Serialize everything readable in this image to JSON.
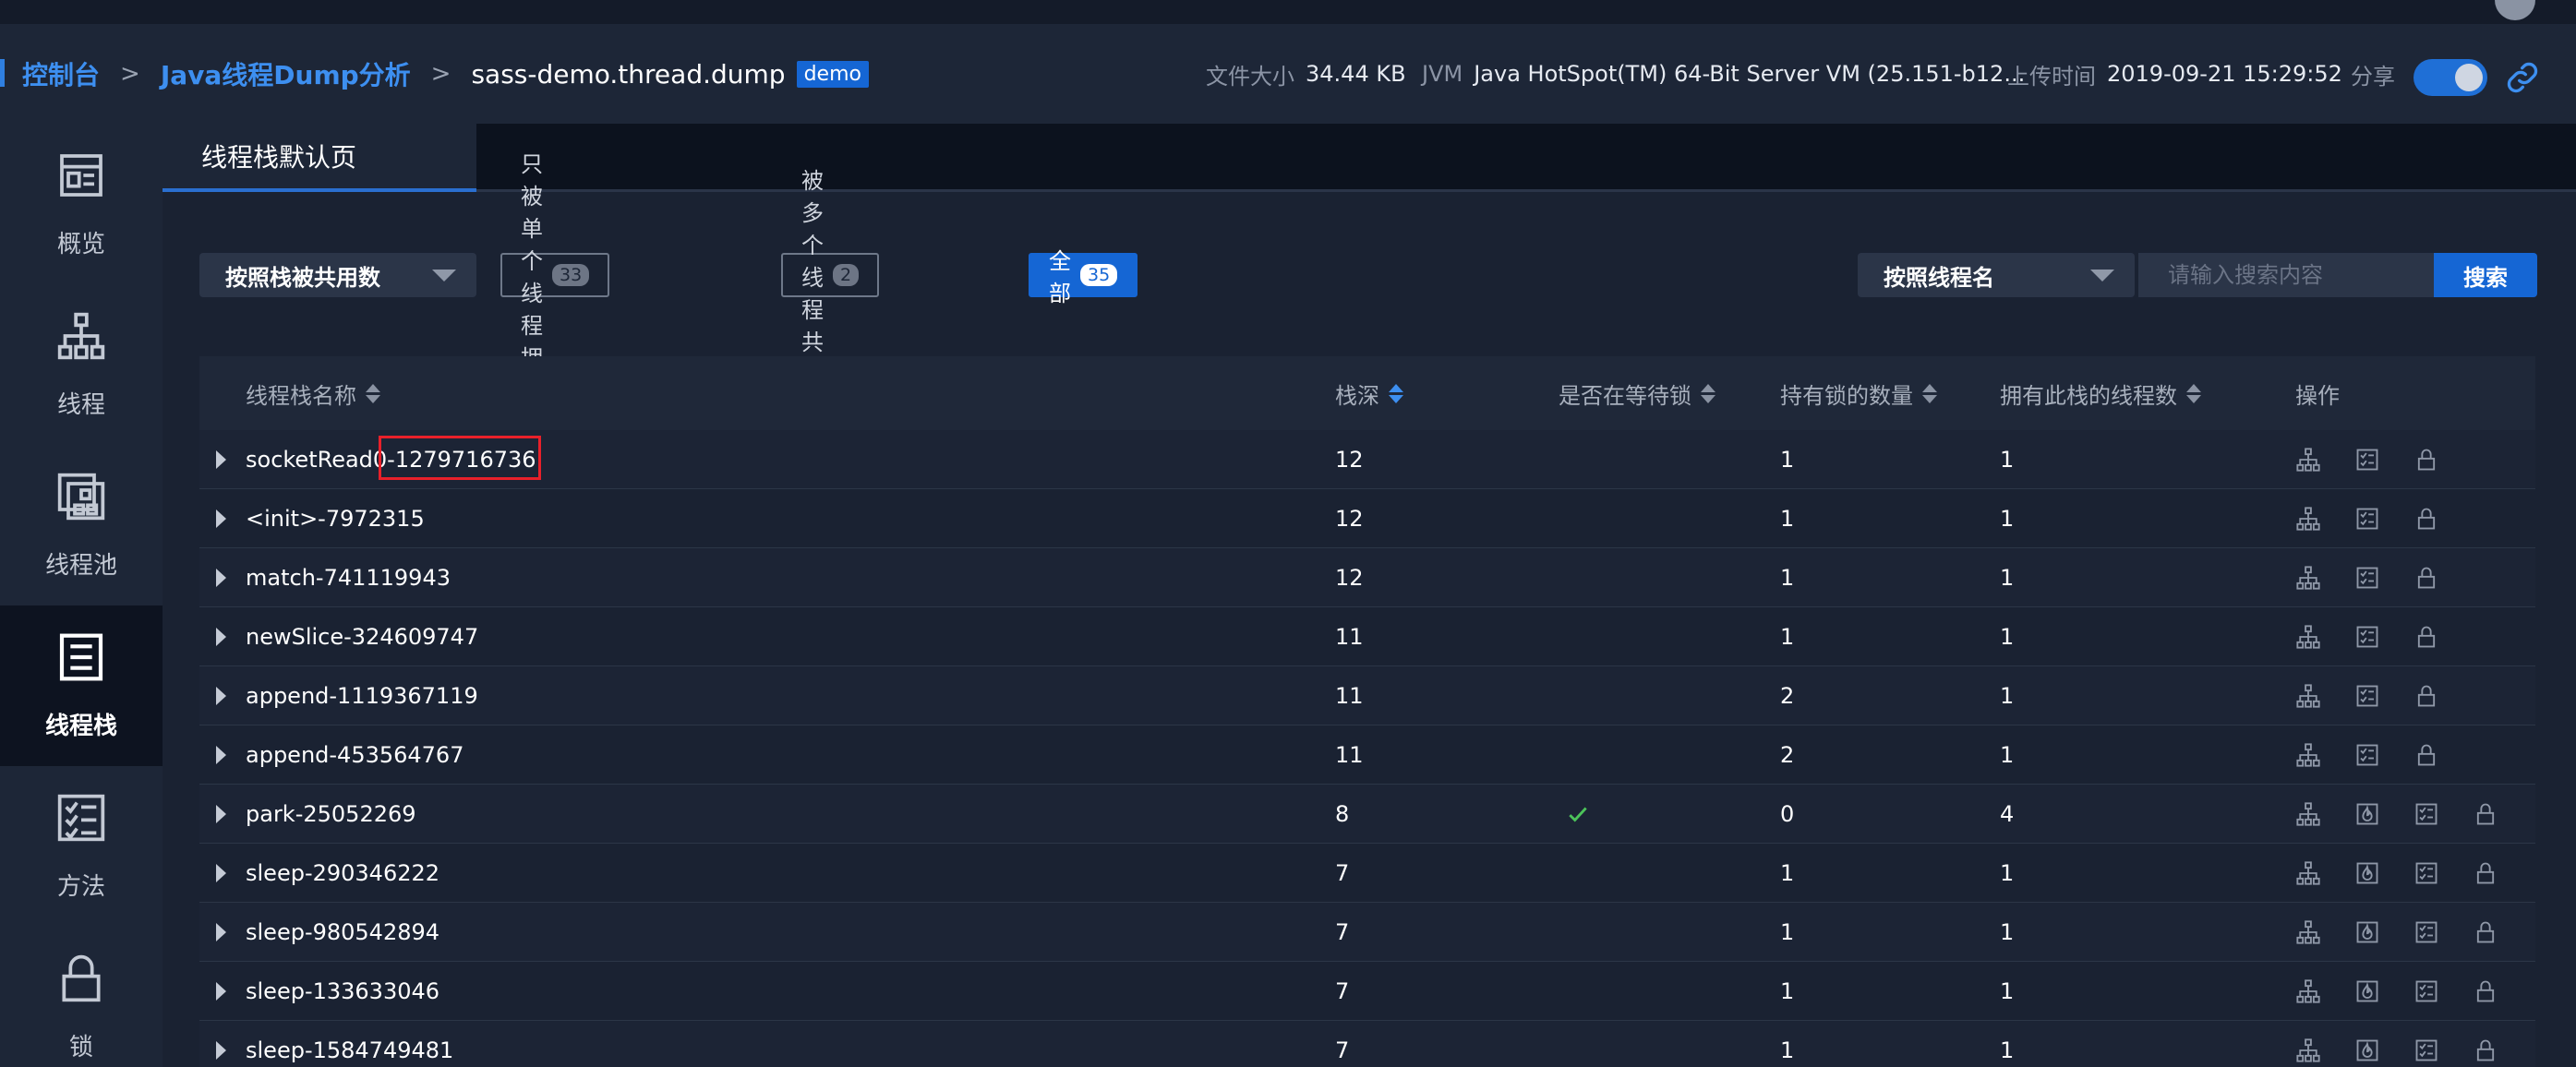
{
  "breadcrumb": {
    "console": "控制台",
    "sep1": ">",
    "analysis": "Java线程Dump分析",
    "sep2": ">",
    "file": "sass-demo.thread.dump",
    "tag": "demo"
  },
  "meta": {
    "size_label": "文件大小",
    "size_value": "34.44 KB",
    "jvm_label": "JVM",
    "jvm_value": "Java HotSpot(TM) 64-Bit Server VM (25.151-b12...",
    "upload_label": "上传时间",
    "upload_value": "2019-09-21 15:29:52",
    "share_label": "分享",
    "share_enabled": true
  },
  "sidebar": {
    "items": [
      {
        "label": "概览",
        "icon": "overview-icon",
        "active": false
      },
      {
        "label": "线程",
        "icon": "thread-tree-icon",
        "active": false
      },
      {
        "label": "线程池",
        "icon": "thread-pool-icon",
        "active": false
      },
      {
        "label": "线程栈",
        "icon": "thread-stack-icon",
        "active": true
      },
      {
        "label": "方法",
        "icon": "method-list-icon",
        "active": false
      },
      {
        "label": "锁",
        "icon": "lock-icon",
        "active": false
      }
    ]
  },
  "tabs": [
    {
      "label": "线程栈默认页",
      "active": true
    }
  ],
  "filters": {
    "sort_select": "按照栈被共用数",
    "single": {
      "label": "只被单个线程拥有",
      "count": "33"
    },
    "multi": {
      "label": "被多个线程共用",
      "count": "2"
    },
    "all": {
      "label": "全部",
      "count": "35",
      "active": true
    },
    "search_select": "按照线程名",
    "search_placeholder": "请输入搜索内容",
    "search_button": "搜索"
  },
  "table": {
    "columns": [
      "线程栈名称",
      "栈深",
      "是否在等待锁",
      "持有锁的数量",
      "拥有此栈的线程数",
      "操作"
    ],
    "rows": [
      {
        "name": "socketRead0-1279716736",
        "depth": "12",
        "waiting": false,
        "locks": "1",
        "threads": "1",
        "ops": [
          "tree-icon",
          "detail-icon",
          "lock-icon"
        ]
      },
      {
        "name": "<init>-7972315",
        "depth": "12",
        "waiting": false,
        "locks": "1",
        "threads": "1",
        "ops": [
          "tree-icon",
          "detail-icon",
          "lock-icon"
        ]
      },
      {
        "name": "match-741119943",
        "depth": "12",
        "waiting": false,
        "locks": "1",
        "threads": "1",
        "ops": [
          "tree-icon",
          "detail-icon",
          "lock-icon"
        ]
      },
      {
        "name": "newSlice-324609747",
        "depth": "11",
        "waiting": false,
        "locks": "1",
        "threads": "1",
        "ops": [
          "tree-icon",
          "detail-icon",
          "lock-icon"
        ]
      },
      {
        "name": "append-1119367119",
        "depth": "11",
        "waiting": false,
        "locks": "2",
        "threads": "1",
        "ops": [
          "tree-icon",
          "detail-icon",
          "lock-icon"
        ]
      },
      {
        "name": "append-453564767",
        "depth": "11",
        "waiting": false,
        "locks": "2",
        "threads": "1",
        "ops": [
          "tree-icon",
          "detail-icon",
          "lock-icon"
        ]
      },
      {
        "name": "park-25052269",
        "depth": "8",
        "waiting": true,
        "locks": "0",
        "threads": "4",
        "ops": [
          "tree-icon",
          "flame-icon",
          "detail-icon",
          "lock-icon"
        ]
      },
      {
        "name": "sleep-290346222",
        "depth": "7",
        "waiting": false,
        "locks": "1",
        "threads": "1",
        "ops": [
          "tree-icon",
          "flame-icon",
          "detail-icon",
          "lock-icon"
        ]
      },
      {
        "name": "sleep-980542894",
        "depth": "7",
        "waiting": false,
        "locks": "1",
        "threads": "1",
        "ops": [
          "tree-icon",
          "flame-icon",
          "detail-icon",
          "lock-icon"
        ]
      },
      {
        "name": "sleep-133633046",
        "depth": "7",
        "waiting": false,
        "locks": "1",
        "threads": "1",
        "ops": [
          "tree-icon",
          "flame-icon",
          "detail-icon",
          "lock-icon"
        ]
      },
      {
        "name": "sleep-1584749481",
        "depth": "7",
        "waiting": false,
        "locks": "1",
        "threads": "1",
        "ops": [
          "tree-icon",
          "flame-icon",
          "detail-icon",
          "lock-icon"
        ]
      }
    ]
  },
  "colors": {
    "accent": "#1566d4",
    "link": "#3d8ff0",
    "check": "#4cc35a",
    "highlight": "#e8202a"
  }
}
